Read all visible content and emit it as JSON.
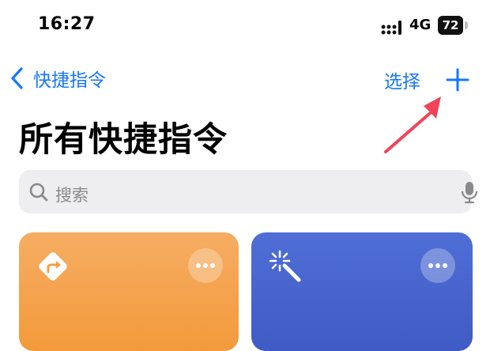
{
  "status_bar": {
    "time": "16:27",
    "network": "4G",
    "battery": "72"
  },
  "nav": {
    "back_label": "快捷指令",
    "select_label": "选择",
    "add_icon": "plus-icon"
  },
  "page": {
    "title": "所有快捷指令"
  },
  "search": {
    "placeholder": "搜索"
  },
  "cards": [
    {
      "icon": "directions-diamond-icon",
      "color": "#f6a54e"
    },
    {
      "icon": "magic-wand-icon",
      "color": "#4966cf"
    }
  ],
  "colors": {
    "accent": "#1677ff",
    "annotation_arrow": "#f0445a"
  }
}
